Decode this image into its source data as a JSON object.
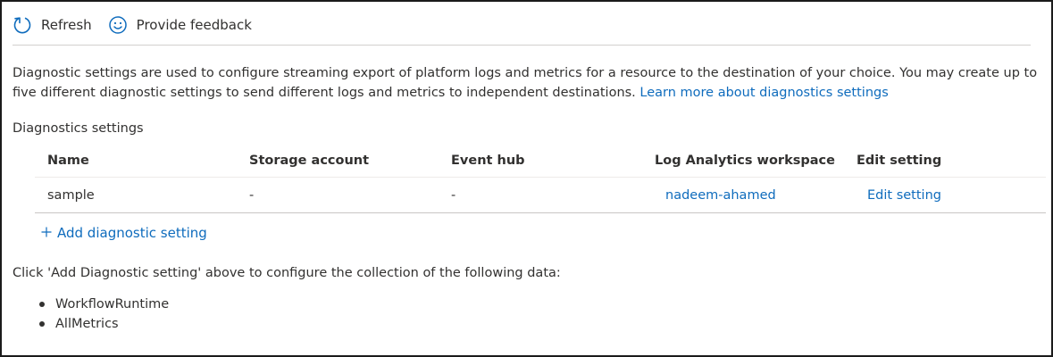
{
  "toolbar": {
    "refresh_label": "Refresh",
    "refresh_icon": "refresh-icon",
    "feedback_label": "Provide feedback",
    "feedback_icon": "smiley-icon"
  },
  "description": {
    "text": "Diagnostic settings are used to configure streaming export of platform logs and metrics for a resource to the destination of your choice. You may create up to five different diagnostic settings to send different logs and metrics to independent destinations.",
    "link_text": "Learn more about diagnostics settings"
  },
  "section_title": "Diagnostics settings",
  "table": {
    "columns": [
      "Name",
      "Storage account",
      "Event hub",
      "Log Analytics workspace",
      "Edit setting"
    ],
    "rows": [
      {
        "name": "sample",
        "storage_account": "-",
        "event_hub": "-",
        "log_analytics_workspace": "nadeem-ahamed",
        "edit_setting": "Edit setting"
      }
    ]
  },
  "add_setting": {
    "icon": "plus-icon",
    "label": "Add diagnostic setting"
  },
  "instruction": "Click 'Add Diagnostic setting' above to configure the collection of the following data:",
  "data_items": [
    "WorkflowRuntime",
    "AllMetrics"
  ],
  "colors": {
    "accent": "#0f6cbd",
    "text": "#323130",
    "divider": "#d2d0ce"
  }
}
